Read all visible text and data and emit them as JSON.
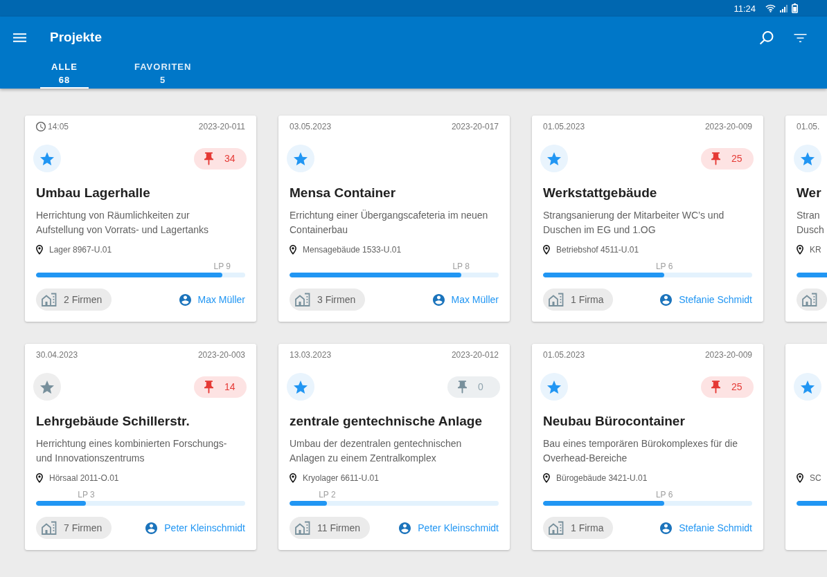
{
  "status_bar": {
    "time": "11:24"
  },
  "app_bar": {
    "title": "Projekte"
  },
  "tabs": [
    {
      "label": "ALLE",
      "count": "68",
      "selected": true
    },
    {
      "label": "FAVORITEN",
      "count": "5",
      "selected": false
    }
  ],
  "rows": [
    {
      "cards": [
        {
          "kind": "full",
          "stamp": {
            "kind": "time",
            "text": "14:05"
          },
          "number": "2023-20-011",
          "favorite": true,
          "pins": {
            "count": "34",
            "active": true
          },
          "title": "Umbau Lagerhalle",
          "description": "Herrichtung von Räumlichkeiten zur Aufstellung von Vorrats- und Lagertanks",
          "location": "Lager 8967-U.01",
          "progress": {
            "level": 0.89,
            "label": "LP 9"
          },
          "firms": "2 Firmen",
          "manager": "Max Müller"
        },
        {
          "kind": "full",
          "stamp": {
            "kind": "date",
            "text": "03.05.2023"
          },
          "number": "2023-20-017",
          "favorite": true,
          "title": "Mensa Container",
          "description": "Errichtung einer Übergangscafeteria im neuen Containerbau",
          "location": "Mensagebäude 1533-U.01",
          "progress": {
            "level": 0.82,
            "label": "LP 8"
          },
          "firms": "3 Firmen",
          "manager": "Max Müller"
        },
        {
          "kind": "full",
          "stamp": {
            "kind": "date",
            "text": "01.05.2023"
          },
          "number": "2023-20-009",
          "favorite": true,
          "pins": {
            "count": "25",
            "active": true
          },
          "title": "Werkstattgebäude",
          "description": "Strangsanierung der Mitarbeiter WC’s und Duschen im EG und 1.OG",
          "location": "Betriebshof 4511-U.01",
          "progress": {
            "level": 0.58,
            "label": "LP 6"
          },
          "firms": "1 Firma",
          "manager": "Stefanie Schmidt"
        },
        {
          "kind": "partial",
          "stamp": {
            "kind": "date",
            "text": "01.05."
          },
          "favorite": true,
          "title": "Wer",
          "description": "Stran Dusch",
          "location": "KR",
          "progress": {
            "level": 0.58
          },
          "chip": true
        }
      ]
    },
    {
      "cards": [
        {
          "kind": "full",
          "stamp": {
            "kind": "date",
            "text": "30.04.2023"
          },
          "number": "2023-20-003",
          "favorite": false,
          "pins": {
            "count": "14",
            "active": true
          },
          "title": "Lehrgebäude Schillerstr.",
          "description": "Herrichtung eines kombinierten Forschungs- und Innovationszentrums",
          "location": "Hörsaal 2011-O.01",
          "progress": {
            "level": 0.24,
            "label": "LP 3"
          },
          "firms": "7 Firmen",
          "manager": "Peter Kleinschmidt"
        },
        {
          "kind": "full",
          "stamp": {
            "kind": "date",
            "text": "13.03.2023"
          },
          "number": "2023-20-012",
          "favorite": true,
          "pins": {
            "count": "0",
            "active": false
          },
          "title": "zentrale gentechnische Anlage",
          "description": "Umbau der dezentralen gentechnischen Anlagen zu einem Zentralkomplex",
          "location": "Kryolager 6611-U.01",
          "progress": {
            "level": 0.18,
            "label": "LP 2"
          },
          "firms": "11 Firmen",
          "manager": "Peter Kleinschmidt"
        },
        {
          "kind": "full",
          "stamp": {
            "kind": "date",
            "text": "01.05.2023"
          },
          "number": "2023-20-009",
          "favorite": true,
          "pins": {
            "count": "25",
            "active": true
          },
          "title": "Neubau Bürocontainer",
          "description": "Bau eines temporären Bürokomplexes für die Overhead-Bereiche",
          "location": "Bürogebäude 3421-U.01",
          "progress": {
            "level": 0.58,
            "label": "LP 6"
          },
          "firms": "1 Firma",
          "manager": "Stefanie Schmidt"
        },
        {
          "kind": "partial",
          "favorite": true,
          "location": "SC",
          "progress": {
            "level": 0.5
          }
        }
      ]
    }
  ]
}
